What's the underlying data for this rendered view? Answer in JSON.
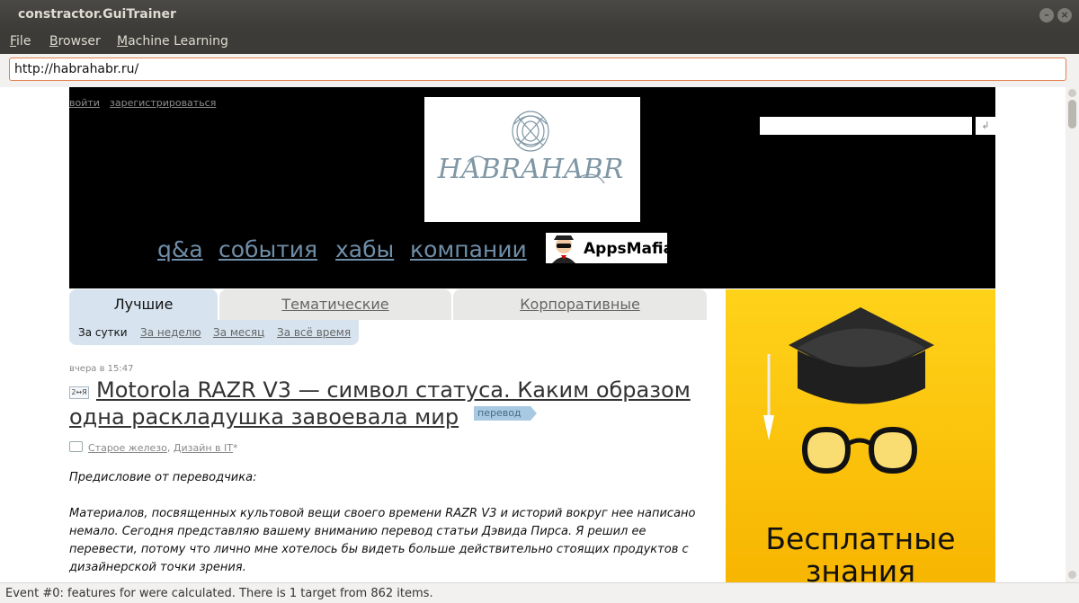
{
  "window": {
    "title": "constractor.GuiTrainer"
  },
  "menu": [
    {
      "first": "F",
      "rest": "ile"
    },
    {
      "first": "B",
      "rest": "rowser"
    },
    {
      "first": "M",
      "rest": "achine Learning"
    }
  ],
  "address": {
    "url": "http://habrahabr.ru/"
  },
  "site": {
    "auth": {
      "login": "войти",
      "register": "зарегистрироваться"
    },
    "logo_text": "HABRAHABR",
    "search_btn": "↲",
    "nav": [
      "q&a",
      "события",
      "хабы",
      "компании"
    ],
    "apps_label": "AppsMafia"
  },
  "tabs": [
    "Лучшие",
    "Тематические",
    "Корпоративные"
  ],
  "filters": [
    "За сутки",
    "За неделю",
    "За месяц",
    "За всё время"
  ],
  "post": {
    "date": "вчера в 15:47",
    "title_icon": "2↔Я",
    "title": "Motorola RAZR V3 — символ статуса. Каким образом одна раскладушка завоевала мир",
    "badge": "перевод",
    "hub1": "Старое железо",
    "hub2": "Дизайн в IT",
    "hub2_mark": "*",
    "intro": "Предисловие от переводчика:",
    "paragraph": "Материалов, посвященных культовой вещи своего времени RAZR V3 и историй вокруг нее написано немало. Сегодня представляю вашему вниманию перевод статьи Дэвида Пирса. Я решил ее перевести, потому что лично мне хотелось бы видеть больше действительно стоящих продуктов с дизайнерской точки зрения."
  },
  "ad": {
    "line1": "Бесплатные",
    "line2": "знания"
  },
  "status": {
    "text": "Event #0: features for were calculated. There is 1 target from 862 items."
  }
}
